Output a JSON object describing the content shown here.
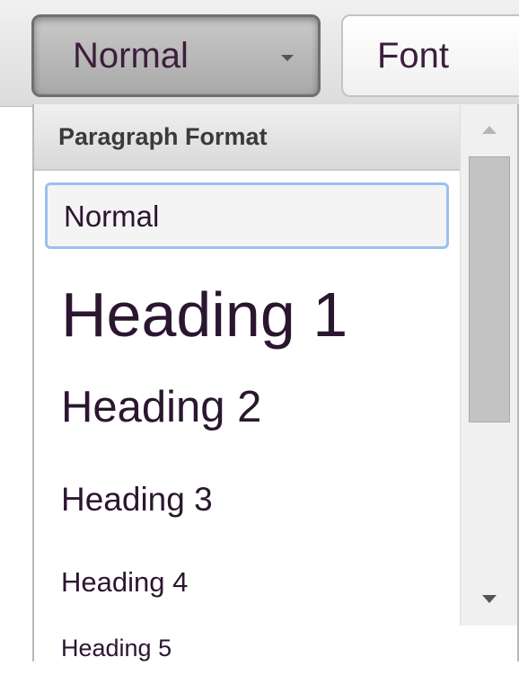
{
  "toolbar": {
    "format_combo_value": "Normal",
    "font_combo_value": "Font"
  },
  "dropdown": {
    "header": "Paragraph Format",
    "items": [
      {
        "label": "Normal",
        "selected": true
      },
      {
        "label": "Heading 1"
      },
      {
        "label": "Heading 2"
      },
      {
        "label": "Heading 3"
      },
      {
        "label": "Heading 4"
      },
      {
        "label": "Heading 5"
      }
    ]
  },
  "colors": {
    "selection_border": "#9cc0ef",
    "item_text": "#2b1630"
  },
  "icons": {
    "combo_caret": "chevron-down-icon",
    "scroll_up": "scroll-up-arrow-icon",
    "scroll_down": "scroll-down-arrow-icon"
  }
}
